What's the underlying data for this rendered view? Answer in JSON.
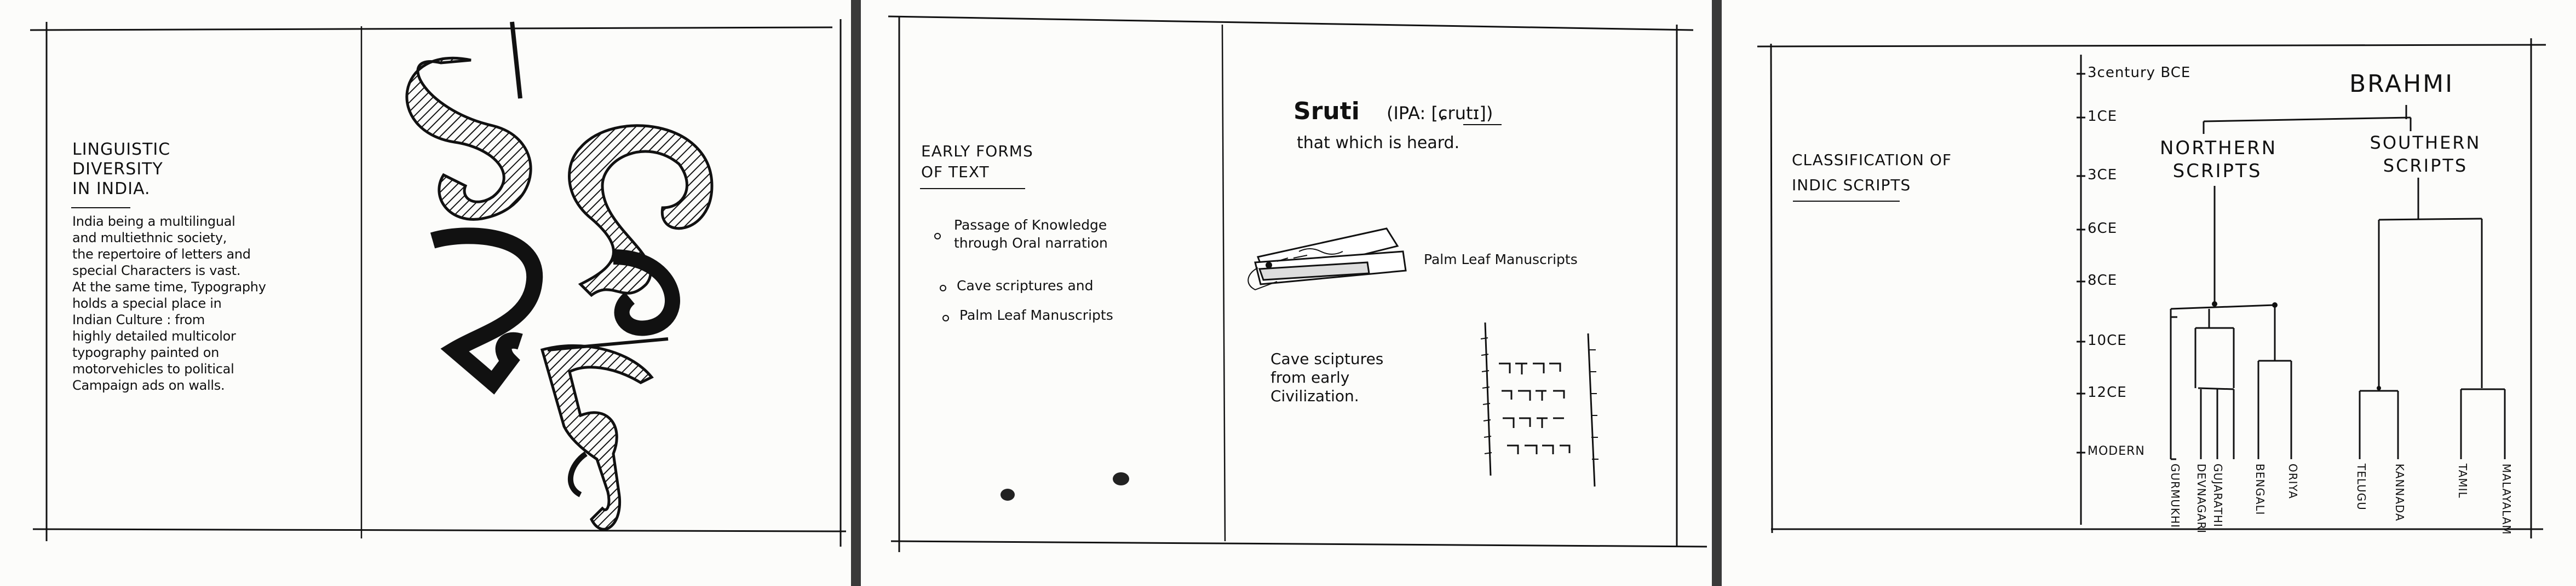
{
  "panel1": {
    "title_lines": "LINGUISTIC\nDIVERSITY\nIN INDIA.",
    "body": "India being a multilingual\nand multiethnic society,\nthe repertoire of letters and\nspecial Characters is vast.\nAt the same time, Typography\nholds a special place in\nIndian Culture : from\nhighly detailed multicolor\ntypography painted on\nmotorvehicles to political\nCampaign ads on walls."
  },
  "panel2": {
    "title_lines": "EARLY FORMS\nOF TEXT",
    "bullets": [
      "Passage of Knowledge\nthrough Oral narration",
      "Cave scriptures and",
      "Palm Leaf Manuscripts"
    ],
    "sruti_word": "Sruti",
    "sruti_ipa": "(IPA: [ɕrutɪ])",
    "sruti_meaning": "that which is heard.",
    "palm_leaf_caption": "Palm Leaf Manuscripts",
    "cave_caption": "Cave sciptures\nfrom early\nCivilization."
  },
  "panel3": {
    "title_lines": "CLASSIFICATION OF\nINDIC SCRIPTS",
    "timeline": [
      "3century BCE",
      "1CE",
      "3CE",
      "6CE",
      "8CE",
      "10CE",
      "12CE",
      "MODERN"
    ],
    "root": "BRAHMI",
    "northern": "NORTHERN\nSCRIPTS",
    "southern": "SOUTHERN\nSCRIPTS",
    "leaves": [
      "GURMUKHI",
      "DEVNAGARI",
      "GUJARATHI",
      "BENGALI",
      "ORIYA",
      "TELUGU",
      "KANNADA",
      "TAMIL",
      "MALAYALAM"
    ]
  }
}
